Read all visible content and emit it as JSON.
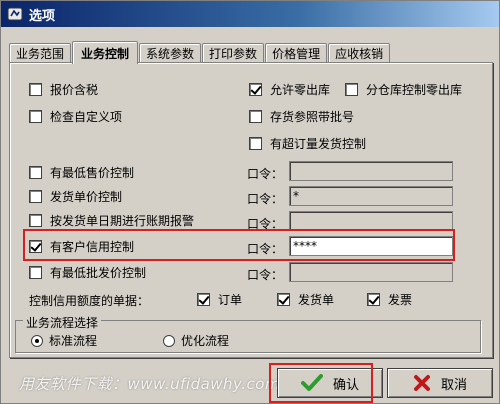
{
  "window": {
    "title": "选项"
  },
  "tabs": [
    {
      "label": "业务范围",
      "active": false
    },
    {
      "label": "业务控制",
      "active": true
    },
    {
      "label": "系统参数",
      "active": false
    },
    {
      "label": "打印参数",
      "active": false
    },
    {
      "label": "价格管理",
      "active": false
    },
    {
      "label": "应收核销",
      "active": false
    }
  ],
  "left_options": {
    "quote_tax": {
      "label": "报价含税",
      "checked": false
    },
    "check_custom": {
      "label": "检查自定义项",
      "checked": false
    },
    "min_price": {
      "label": "有最低售价控制",
      "checked": false
    },
    "ship_price": {
      "label": "发货单价控制",
      "checked": false
    },
    "ship_date_alert": {
      "label": "按发货单日期进行账期报警",
      "checked": false
    },
    "credit_control": {
      "label": "有客户信用控制",
      "checked": true
    },
    "min_wholesale": {
      "label": "有最低批发价控制",
      "checked": false
    }
  },
  "right_options": {
    "allow_zero_out": {
      "label": "允许零出库",
      "checked": true
    },
    "warehouse_zero_out": {
      "label": "分仓库控制零出库",
      "checked": false
    },
    "stock_batch": {
      "label": "存货参照带批号",
      "checked": false
    },
    "over_order": {
      "label": "有超订量发货控制",
      "checked": false
    }
  },
  "passwords": {
    "label": "口令：",
    "min_price_value": "",
    "ship_price_value": "*",
    "ship_date_value": "",
    "credit_value": "****",
    "min_wholesale_value": ""
  },
  "credit_docs": {
    "label": "控制信用额度的单据：",
    "order": {
      "label": "订单",
      "checked": true
    },
    "ship": {
      "label": "发货单",
      "checked": true
    },
    "invoice": {
      "label": "发票",
      "checked": true
    }
  },
  "process": {
    "title": "业务流程选择",
    "standard": {
      "label": "标准流程",
      "selected": true
    },
    "optimized": {
      "label": "优化流程",
      "selected": false
    }
  },
  "buttons": {
    "confirm": "确认",
    "cancel": "取消"
  },
  "watermark": "用友软件下载：www.ufidawhy.com",
  "colors": {
    "highlight": "#d42020",
    "dialog_bg": "#d4d0c8"
  }
}
